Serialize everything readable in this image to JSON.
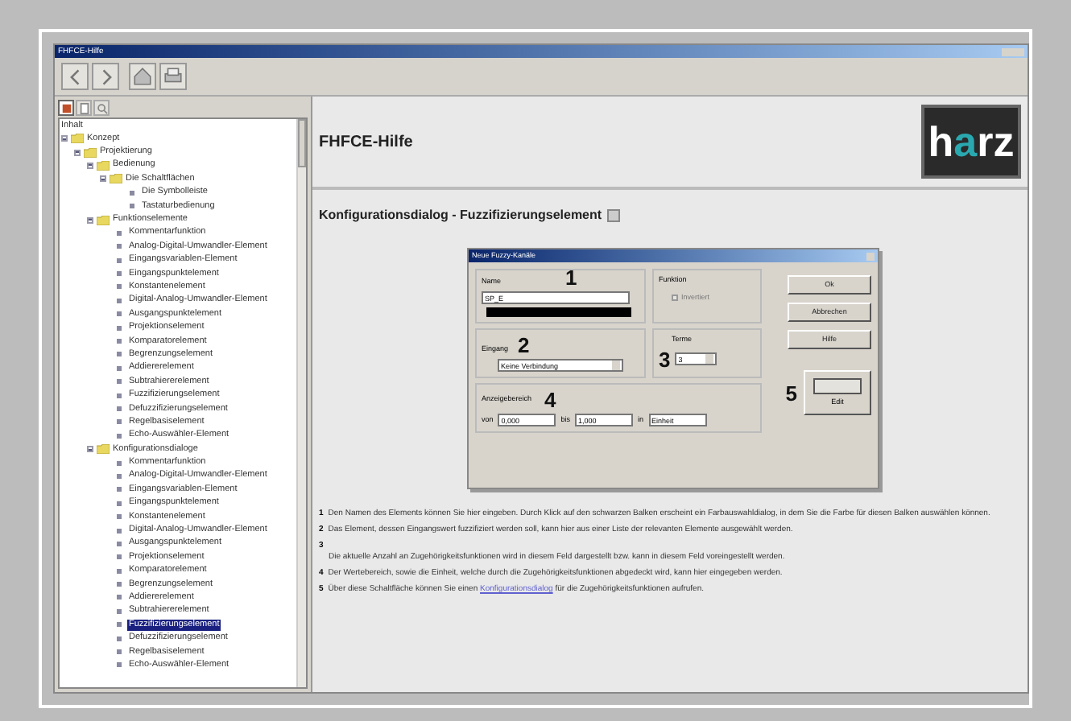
{
  "window": {
    "title": "FHFCE-Hilfe"
  },
  "toolbar": {
    "buttons": [
      {
        "kind": "back"
      },
      {
        "kind": "forward"
      },
      {
        "kind": "home"
      },
      {
        "kind": "print"
      }
    ]
  },
  "nav_tabs": [
    {
      "kind": "contents",
      "selected": true
    },
    {
      "kind": "index",
      "selected": false
    },
    {
      "kind": "search",
      "selected": false
    }
  ],
  "tree": {
    "header": "Inhalt",
    "items": [
      {
        "label": "Konzept",
        "kind": "folder",
        "expanded": true,
        "selected": false,
        "children": [
          {
            "label": "Projektierung",
            "kind": "folder",
            "expanded": true,
            "selected": false,
            "children": [
              {
                "label": "Bedienung",
                "kind": "folder",
                "expanded": true,
                "selected": false,
                "children": [
                  {
                    "label": "Die Schaltflächen",
                    "kind": "folder",
                    "expanded": true,
                    "selected": false,
                    "children": [
                      {
                        "label": "Die Symbolleiste",
                        "kind": "page",
                        "selected": false
                      },
                      {
                        "label": "Tastaturbedienung",
                        "kind": "page",
                        "selected": false
                      }
                    ]
                  }
                ]
              },
              {
                "label": "Funktionselemente",
                "kind": "folder",
                "expanded": true,
                "selected": false,
                "children": [
                  {
                    "label": "Kommentarfunktion",
                    "kind": "page",
                    "selected": false
                  },
                  {
                    "label": "Analog-Digital-Umwandler-Element",
                    "kind": "page",
                    "selected": false
                  },
                  {
                    "label": "Eingangsvariablen-Element",
                    "kind": "page",
                    "selected": false
                  },
                  {
                    "label": "Eingangspunktelement",
                    "kind": "page",
                    "selected": false
                  },
                  {
                    "label": "Konstantenelement",
                    "kind": "page",
                    "selected": false
                  },
                  {
                    "label": "Digital-Analog-Umwandler-Element",
                    "kind": "page",
                    "selected": false
                  },
                  {
                    "label": "Ausgangspunktelement",
                    "kind": "page",
                    "selected": false
                  },
                  {
                    "label": "Projektionselement",
                    "kind": "page",
                    "selected": false
                  },
                  {
                    "label": "Komparatorelement",
                    "kind": "page",
                    "selected": false
                  },
                  {
                    "label": "Begrenzungselement",
                    "kind": "page",
                    "selected": false
                  },
                  {
                    "label": "Addiererelement",
                    "kind": "page",
                    "selected": false
                  },
                  {
                    "label": "Subtrahiererelement",
                    "kind": "page",
                    "selected": false
                  },
                  {
                    "label": "Fuzzifizierungselement",
                    "kind": "page",
                    "selected": false
                  },
                  {
                    "label": "Defuzzifizierungselement",
                    "kind": "page",
                    "selected": false
                  },
                  {
                    "label": "Regelbasiselement",
                    "kind": "page",
                    "selected": false
                  },
                  {
                    "label": "Echo-Auswähler-Element",
                    "kind": "page",
                    "selected": false
                  }
                ]
              },
              {
                "label": "Konfigurationsdialoge",
                "kind": "folder",
                "expanded": true,
                "selected": false,
                "children": [
                  {
                    "label": "Kommentarfunktion",
                    "kind": "page",
                    "selected": false
                  },
                  {
                    "label": "Analog-Digital-Umwandler-Element",
                    "kind": "page",
                    "selected": false
                  },
                  {
                    "label": "Eingangsvariablen-Element",
                    "kind": "page",
                    "selected": false
                  },
                  {
                    "label": "Eingangspunktelement",
                    "kind": "page",
                    "selected": false
                  },
                  {
                    "label": "Konstantenelement",
                    "kind": "page",
                    "selected": false
                  },
                  {
                    "label": "Digital-Analog-Umwandler-Element",
                    "kind": "page",
                    "selected": false
                  },
                  {
                    "label": "Ausgangspunktelement",
                    "kind": "page",
                    "selected": false
                  },
                  {
                    "label": "Projektionselement",
                    "kind": "page",
                    "selected": false
                  },
                  {
                    "label": "Komparatorelement",
                    "kind": "page",
                    "selected": false
                  },
                  {
                    "label": "Begrenzungselement",
                    "kind": "page",
                    "selected": false
                  },
                  {
                    "label": "Addiererelement",
                    "kind": "page",
                    "selected": false
                  },
                  {
                    "label": "Subtrahiererelement",
                    "kind": "page",
                    "selected": false
                  },
                  {
                    "label": "Fuzzifizierungselement",
                    "kind": "page",
                    "selected": true
                  },
                  {
                    "label": "Defuzzifizierungselement",
                    "kind": "page",
                    "selected": false
                  },
                  {
                    "label": "Regelbasiselement",
                    "kind": "page",
                    "selected": false
                  },
                  {
                    "label": "Echo-Auswähler-Element",
                    "kind": "page",
                    "selected": false
                  }
                ]
              }
            ]
          }
        ]
      }
    ]
  },
  "content": {
    "header_title": "FHFCE-Hilfe",
    "logo": {
      "parts": [
        {
          "text": "h",
          "accent": false
        },
        {
          "text": "a",
          "accent": true
        },
        {
          "text": "rz",
          "accent": false
        }
      ]
    },
    "heading": "Konfigurationsdialog - Fuzzifizierungselement",
    "dialog": {
      "title": "Neue Fuzzy-Kanäle",
      "name_label": "Name",
      "name_value": "SP_E",
      "funktion_label": "Funktion",
      "checkbox": {
        "label": "Invertiert",
        "checked": false,
        "disabled": true
      },
      "buttons": [
        "Ok",
        "Abbrechen",
        "Hilfe"
      ],
      "eingang_label": "Eingang",
      "eingang_value": "Keine Verbindung",
      "terme_label": "Terme",
      "terme_value": "3",
      "edit_label": "Edit",
      "range_label": "Anzeigebereich",
      "from_label": "von",
      "from_value": "0,000",
      "to_label": "bis",
      "to_value": "1,000",
      "unit_label": "in",
      "unit_value": "Einheit",
      "callouts": [
        "1",
        "2",
        "3",
        "4",
        "5"
      ]
    },
    "notes": [
      {
        "number": "1",
        "kind": "inline",
        "text": "Den Namen des Elements können Sie hier eingeben. Durch Klick auf den schwarzen Balken erscheint ein Farbauswahldialog, in dem Sie die Farbe für diesen Balken auswählen können."
      },
      {
        "number": "2",
        "kind": "inline",
        "text": "Das Element, dessen Eingangswert fuzzifiziert werden soll, kann hier aus einer Liste der relevanten Elemente ausgewählt werden."
      },
      {
        "number": "3",
        "kind": "below",
        "text": "Die aktuelle Anzahl an Zugehörigkeitsfunktionen wird in diesem Feld dargestellt bzw. kann in diesem Feld voreingestellt werden."
      },
      {
        "number": "4",
        "kind": "inline",
        "text": "Der Wertebereich, sowie die Einheit, welche durch die Zugehörigkeitsfunktionen abgedeckt wird, kann hier eingegeben werden."
      },
      {
        "number": "5",
        "kind": "inline",
        "text": "Über diese Schaltfläche können Sie einen",
        "link": "Konfigurationsdialog",
        "after": "für die Zugehörigkeitsfunktionen aufrufen."
      }
    ]
  }
}
